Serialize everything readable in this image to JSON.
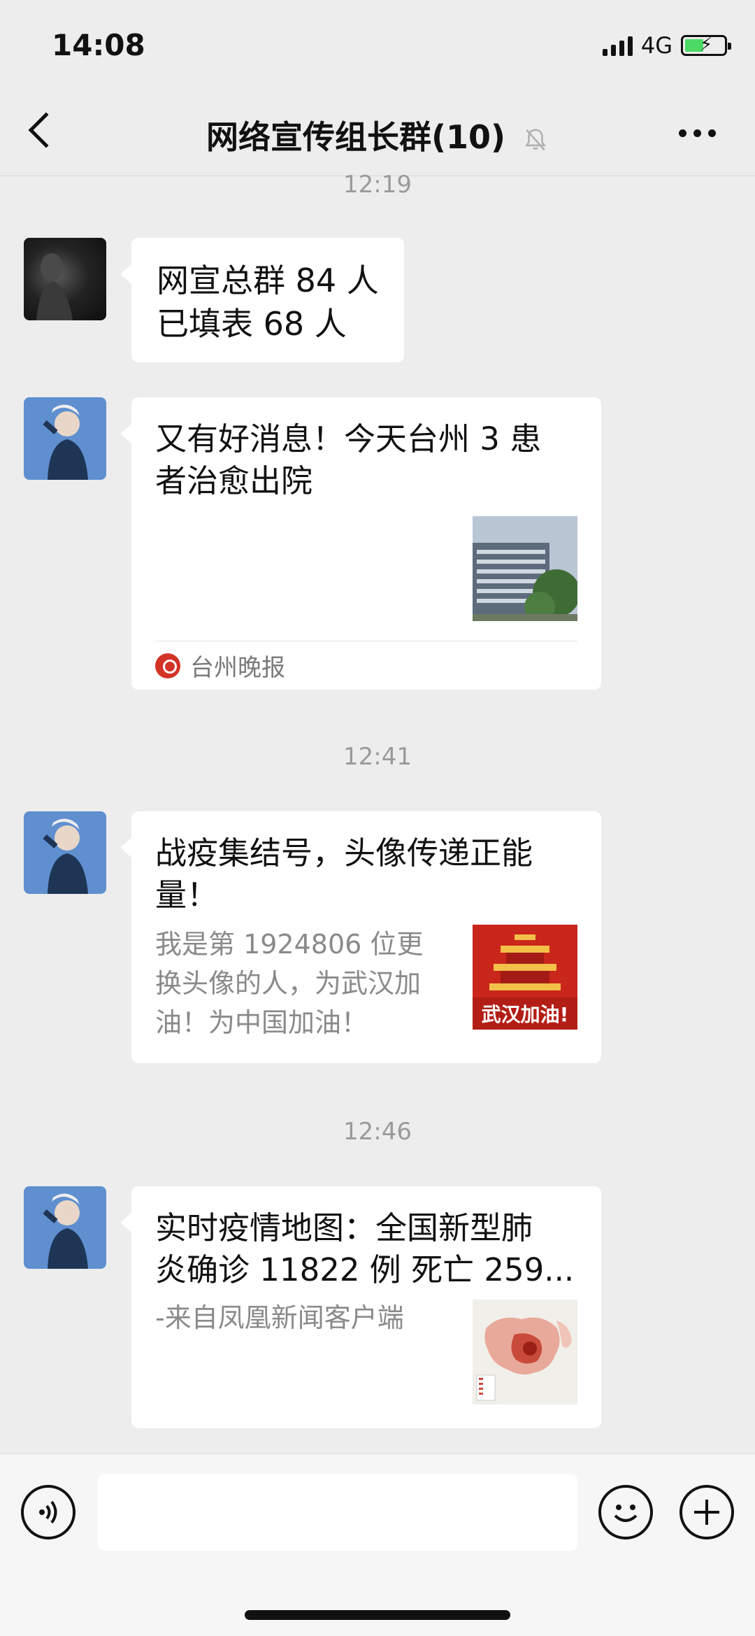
{
  "status_bar": {
    "time": "14:08",
    "network": "4G",
    "battery_charging": true,
    "signal_icon": "signal-bars-icon",
    "battery_icon": "battery-charging-icon"
  },
  "nav": {
    "title": "网络宣传组长群(10)",
    "back_icon": "chevron-left-icon",
    "mute_icon": "bell-muted-icon",
    "more_icon": "more-dots-icon"
  },
  "messages": [
    {
      "type": "timestamp",
      "time": "12:19"
    },
    {
      "type": "text",
      "avatar": "dark-portrait",
      "lines": [
        "网宣总群 84 人",
        "已填表 68 人"
      ]
    },
    {
      "type": "link-card",
      "avatar": "blue-illustration",
      "title_lines": [
        "又有好消息！今天台州 3 患",
        "者治愈出院"
      ],
      "source": "台州晚报",
      "thumb": "hospital-building"
    },
    {
      "type": "timestamp",
      "time": "12:41"
    },
    {
      "type": "link-card",
      "avatar": "blue-illustration",
      "title_lines": [
        "战疫集结号，头像传递正能",
        "量！"
      ],
      "desc_lines": [
        "我是第 1924806 位更",
        "换头像的人，为武汉加",
        "油！为中国加油！"
      ],
      "thumb": "wuhan-poster",
      "thumb_text": "武汉加油!"
    },
    {
      "type": "timestamp",
      "time": "12:46"
    },
    {
      "type": "link-card",
      "avatar": "blue-illustration",
      "title_lines": [
        "实时疫情地图：全国新型肺",
        "炎确诊 11822 例 死亡 259..."
      ],
      "desc_lines": [
        "-来自凤凰新闻客户端"
      ],
      "thumb": "china-map"
    }
  ],
  "input_bar": {
    "voice_icon": "voice-icon",
    "emoji_icon": "emoji-icon",
    "plus_icon": "plus-icon",
    "placeholder": ""
  },
  "colors": {
    "background": "#ededed",
    "bubble": "#ffffff",
    "timestamp": "#9a9a9a",
    "muted_text": "#8a8a8a"
  }
}
